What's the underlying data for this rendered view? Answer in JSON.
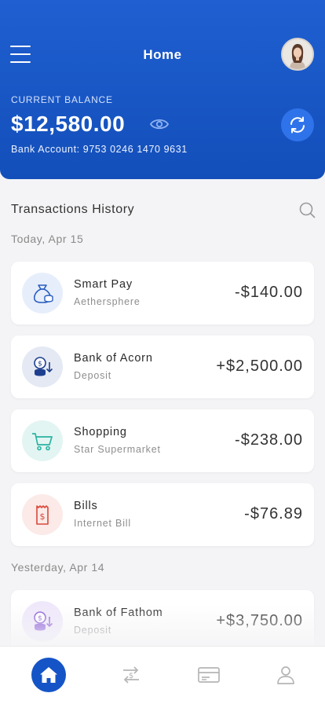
{
  "header": {
    "title": "Home",
    "balance_label": "CURRENT BALANCE",
    "balance": "$12,580.00",
    "account_line": "Bank Account: 9753 0246 1470 9631"
  },
  "history": {
    "title": "Transactions History",
    "groups": [
      {
        "date": "Today, Apr 15",
        "items": [
          {
            "name": "Smart Pay",
            "sub": "Aethersphere",
            "amount": "-$140.00",
            "icon": "money-bag-icon"
          },
          {
            "name": "Bank of Acorn",
            "sub": "Deposit",
            "amount": "+$2,500.00",
            "icon": "coin-deposit-icon"
          },
          {
            "name": "Shopping",
            "sub": "Star Supermarket",
            "amount": "-$238.00",
            "icon": "shopping-cart-icon"
          },
          {
            "name": "Bills",
            "sub": "Internet Bill",
            "amount": "-$76.89",
            "icon": "bill-receipt-icon"
          }
        ]
      },
      {
        "date": "Yesterday, Apr 14",
        "items": [
          {
            "name": "Bank of Fathom",
            "sub": "Deposit",
            "amount": "+$3,750.00",
            "icon": "coin-deposit-icon"
          }
        ]
      }
    ]
  },
  "colors": {
    "primary": "#1554c6",
    "header_top": "#1f5fd1",
    "background": "#f4f4f6",
    "smart_pay_icon": "#2a5fc0",
    "acorn_icon": "#1e3f8f",
    "shopping_icon": "#2ab3a3",
    "bills_icon": "#d9473a",
    "fathom_icon": "#8a5ad8"
  },
  "tabs": [
    "home-icon",
    "transfer-icon",
    "card-icon",
    "profile-icon"
  ]
}
